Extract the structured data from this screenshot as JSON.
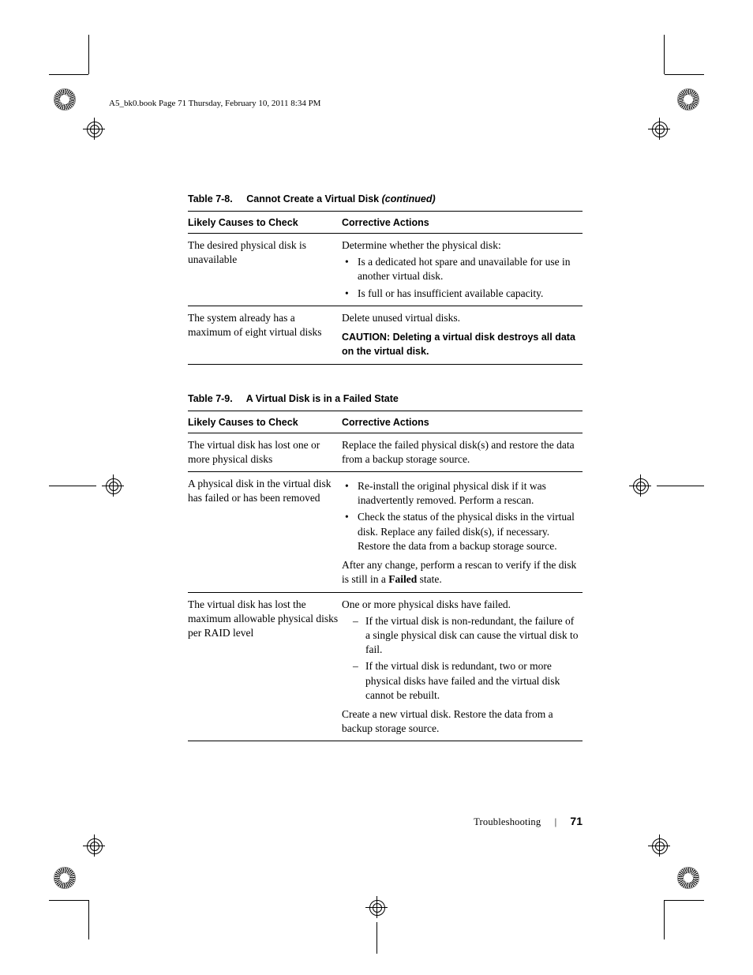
{
  "runhead": "A5_bk0.book  Page 71  Thursday, February 10, 2011  8:34 PM",
  "table8": {
    "caption_num": "Table 7-8.",
    "caption_title": "Cannot Create a Virtual Disk",
    "caption_cont": "(continued)",
    "headers": {
      "c1": "Likely Causes to Check",
      "c2": "Corrective Actions"
    },
    "rows": [
      {
        "cause": "The desired physical disk is unavailable",
        "lead": "Determine whether the physical disk:",
        "bullets": [
          "Is a dedicated hot spare and unavailable for use in another virtual disk.",
          "Is full or has insufficient available capacity."
        ]
      },
      {
        "cause": "The system already has a maximum of eight virtual disks",
        "lead": "Delete unused virtual disks.",
        "caution_label": "CAUTION: ",
        "caution_text": "Deleting a virtual disk destroys all data on the virtual disk."
      }
    ]
  },
  "table9": {
    "caption_num": "Table 7-9.",
    "caption_title": "A Virtual Disk is in a Failed State",
    "headers": {
      "c1": "Likely Causes to Check",
      "c2": "Corrective Actions"
    },
    "rows": [
      {
        "cause": "The virtual disk has lost one or more physical disks",
        "text": "Replace the failed physical disk(s) and restore the data from a backup storage source."
      },
      {
        "cause": "A physical disk in the virtual disk has failed or has been removed",
        "bullets": [
          "Re-install the original physical disk if it was inadvertently removed. Perform a rescan.",
          "Check the status of the physical disks in the virtual disk. Replace any failed disk(s), if necessary. Restore the data from a backup storage source."
        ],
        "after_pre": "After any change, perform a rescan to verify if the disk is still in a ",
        "after_bold": "Failed",
        "after_post": " state."
      },
      {
        "cause": "The virtual disk has lost the maximum allowable physical disks per RAID level",
        "lead": "One or more physical disks have failed.",
        "dashes": [
          "If the virtual disk is non-redundant, the failure of a single physical disk can cause the virtual disk to fail.",
          "If the virtual disk is redundant, two or more physical disks have failed and the virtual disk cannot be rebuilt."
        ],
        "after": "Create a new virtual disk. Restore the data from a backup storage source."
      }
    ]
  },
  "footer": {
    "section": "Troubleshooting",
    "page": "71"
  }
}
